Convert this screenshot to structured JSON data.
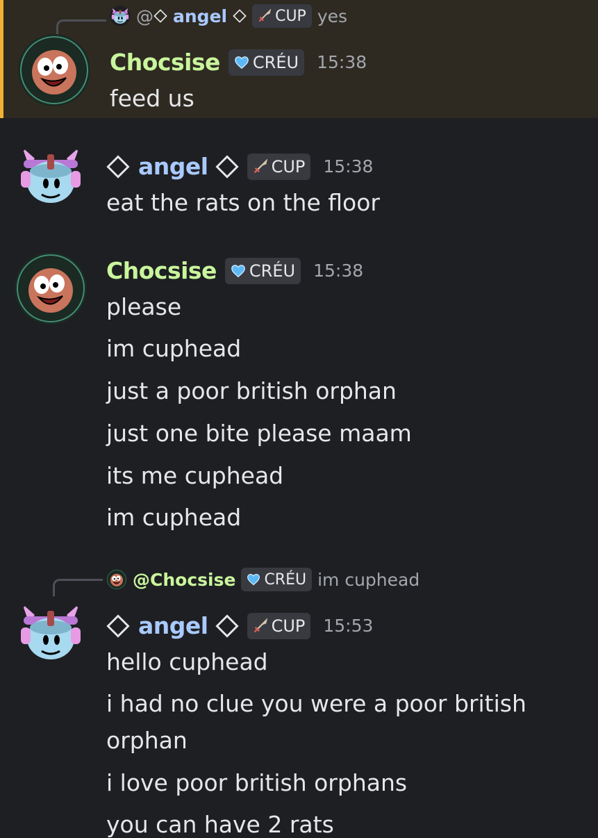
{
  "messages": [
    {
      "reply": {
        "prefix": "@",
        "name": "angel",
        "tag": "CUP",
        "text": "yes"
      },
      "author": "Chocsise",
      "tag": "CRÉU",
      "time": "15:38",
      "lines": [
        "feed us"
      ]
    },
    {
      "author": "angel",
      "tag": "CUP",
      "time": "15:38",
      "lines": [
        "eat the rats on the floor"
      ]
    },
    {
      "author": "Chocsise",
      "tag": "CRÉU",
      "time": "15:38",
      "lines": [
        "please",
        "im cuphead",
        "just a poor british orphan",
        "just one bite please maam",
        "its me cuphead",
        "im cuphead"
      ]
    },
    {
      "reply": {
        "prefix": "@",
        "name": "Chocsise",
        "tag": "CRÉU",
        "text": "im cuphead"
      },
      "author": "angel",
      "tag": "CUP",
      "time": "15:53",
      "lines": [
        "hello cuphead",
        "i had no clue you were a poor british",
        "orphan",
        "i love poor british orphans",
        "you can have 2 rats"
      ]
    }
  ],
  "colors": {
    "background": "#1e1f22",
    "highlight": "#2e2a22",
    "highlight_border": "#f0b232",
    "chocsise_name": "#c9f59c",
    "angel_name": "#a9c9ff"
  },
  "icons": {
    "creu_tag": "blue-heart-icon",
    "cup_tag": "crossed-swords-icon",
    "angel_decoration": "diamond-outline-icon"
  }
}
